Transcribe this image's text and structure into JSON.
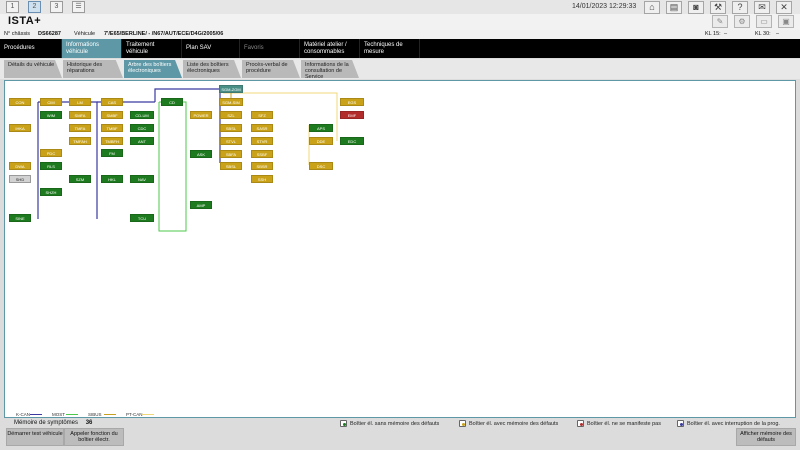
{
  "window_tabs": [
    "1",
    "2",
    "3"
  ],
  "datetime": "14/01/2023 12:29:33",
  "toolbar_icons": [
    "home-icon",
    "document-icon",
    "car-icon",
    "wrench-icon",
    "help-icon",
    "mail-icon",
    "close-icon"
  ],
  "title": "ISTA+",
  "secondary_icons": [
    "edit-icon",
    "gear-icon",
    "message-icon",
    "window-icon"
  ],
  "vehicle": {
    "chassis_label": "N° châssis",
    "chassis_value": "DS66287",
    "vehicle_label": "Véhicule",
    "vehicle_value": "7'/E65/BERLINE/ - /N67/AUT/ECE/D4G/2005/06",
    "kl15_label": "KL 15:",
    "kl15_value": "–",
    "kl30_label": "KL 30:",
    "kl30_value": "–"
  },
  "nav_tabs": [
    {
      "label": "Procédures"
    },
    {
      "label": "Informations véhicule"
    },
    {
      "label": "Traitement véhicule"
    },
    {
      "label": "Plan SAV"
    },
    {
      "label": "Favoris"
    },
    {
      "label": "Matériel atelier / consommables"
    },
    {
      "label": "Techniques de mesure"
    }
  ],
  "sub_tabs": [
    {
      "label": "Détails du véhicule"
    },
    {
      "label": "Historique des réparations"
    },
    {
      "label": "Arbre des boîtiers électroniques"
    },
    {
      "label": "Liste des boîtiers électroniques"
    },
    {
      "label": "Procès-verbal de procédure"
    },
    {
      "label": "Informations de la consultation de Service"
    }
  ],
  "ecus": [
    {
      "label": "CON",
      "color": "y"
    },
    {
      "label": "CIM",
      "color": "y"
    },
    {
      "label": "LM",
      "color": "y"
    },
    {
      "label": "CAS",
      "color": "y"
    },
    {
      "label": "WIM",
      "color": "g"
    },
    {
      "label": "SMFA",
      "color": "y"
    },
    {
      "label": "SMBF",
      "color": "y"
    },
    {
      "label": "CD-UM",
      "color": "g"
    },
    {
      "label": "IHKA",
      "color": "y"
    },
    {
      "label": "TMFA",
      "color": "y"
    },
    {
      "label": "TMBF",
      "color": "y"
    },
    {
      "label": "CDC",
      "color": "g"
    },
    {
      "label": "TMFAH",
      "color": "y"
    },
    {
      "label": "TMBFH",
      "color": "y"
    },
    {
      "label": "ANT",
      "color": "g"
    },
    {
      "label": "PDC",
      "color": "y"
    },
    {
      "label": "FM",
      "color": "g"
    },
    {
      "label": "DWA",
      "color": "y"
    },
    {
      "label": "RLS",
      "color": "g"
    },
    {
      "label": "SHD",
      "color": "gr"
    },
    {
      "label": "SZM",
      "color": "g"
    },
    {
      "label": "HKL",
      "color": "g"
    },
    {
      "label": "NAV",
      "color": "g"
    },
    {
      "label": "SHZH",
      "color": "g"
    },
    {
      "label": "SINE",
      "color": "g"
    },
    {
      "label": "TCU",
      "color": "g"
    },
    {
      "label": "CD",
      "color": "g"
    },
    {
      "label": "ASK",
      "color": "g"
    },
    {
      "label": "AMP",
      "color": "g"
    },
    {
      "label": "SGM-ZGM",
      "color": "t"
    },
    {
      "label": "SGM-SIM",
      "color": "y"
    },
    {
      "label": "POWER",
      "color": "y"
    },
    {
      "label": "SZL",
      "color": "y"
    },
    {
      "label": "SFZ",
      "color": "y"
    },
    {
      "label": "SBSL",
      "color": "y"
    },
    {
      "label": "SASR",
      "color": "y"
    },
    {
      "label": "STVL",
      "color": "y"
    },
    {
      "label": "STVR",
      "color": "y"
    },
    {
      "label": "SBFA",
      "color": "y"
    },
    {
      "label": "SSBF",
      "color": "y"
    },
    {
      "label": "SBSL",
      "color": "y"
    },
    {
      "label": "SBSR",
      "color": "y"
    },
    {
      "label": "SSH",
      "color": "y"
    },
    {
      "label": "APS",
      "color": "g"
    },
    {
      "label": "DDE",
      "color": "y"
    },
    {
      "label": "DSC",
      "color": "y"
    },
    {
      "label": "EGS",
      "color": "y"
    },
    {
      "label": "EMF",
      "color": "r"
    },
    {
      "label": "EDC",
      "color": "g"
    }
  ],
  "bus_legend": [
    {
      "name": "K-CAN",
      "color": "#3a3aa0"
    },
    {
      "name": "MOST",
      "color": "#4cc84c"
    },
    {
      "name": "SIBUS",
      "color": "#c8a020"
    },
    {
      "name": "PT-CAN",
      "color": "#f0d878"
    }
  ],
  "symptoms": {
    "label": "Mémoire de symptômes",
    "count": "36"
  },
  "status_legend": [
    {
      "label": "Boîtier él. sans mémoire des défauts",
      "color": "#1e7a1e"
    },
    {
      "label": "Boîtier él. avec mémoire des défauts",
      "color": "#c9a21a"
    },
    {
      "label": "Boîtier él. ne se manifeste pas",
      "color": "#b22c2c"
    },
    {
      "label": "Boîtier él. avec interruption de la prog.",
      "color": "#3a3aa0"
    }
  ],
  "buttons": {
    "start_test": "Démarrer test véhicule",
    "call_function": "Appeler fonction du boîtier électr.",
    "show_memory": "Afficher mémoire des défauts"
  }
}
